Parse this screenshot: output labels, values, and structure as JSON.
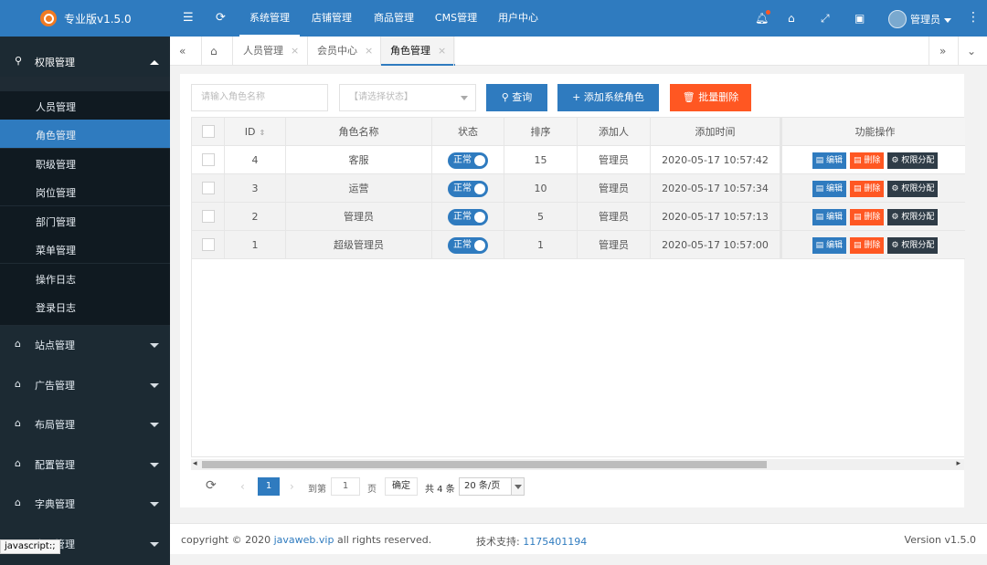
{
  "app": {
    "title": "专业版v1.5.0"
  },
  "header": {
    "nav": [
      "系统管理",
      "店铺管理",
      "商品管理",
      "CMS管理",
      "用户中心"
    ],
    "active_nav": "系统管理",
    "user": "管理员"
  },
  "sidebar": {
    "top_group": "权限管理",
    "items": [
      "人员管理",
      "角色管理",
      "职级管理",
      "岗位管理",
      "部门管理",
      "菜单管理",
      "操作日志",
      "登录日志"
    ],
    "active_item": "角色管理",
    "groups": [
      "站点管理",
      "广告管理",
      "布局管理",
      "配置管理",
      "字典管理",
      "应用管理"
    ]
  },
  "tabs": [
    {
      "label": "人员管理"
    },
    {
      "label": "会员中心"
    },
    {
      "label": "角色管理",
      "active": true
    }
  ],
  "toolbar": {
    "search_placeholder": "请输入角色名称",
    "status_placeholder": "【请选择状态】",
    "query": "查询",
    "add": "添加系统角色",
    "batch_delete": "批量删除"
  },
  "table": {
    "columns": [
      "ID",
      "角色名称",
      "状态",
      "排序",
      "添加人",
      "添加时间",
      "功能操作"
    ],
    "rows": [
      {
        "id": "4",
        "name": "客服",
        "status": "正常",
        "sort": "15",
        "creator": "管理员",
        "time": "2020-05-17 10:57:42"
      },
      {
        "id": "3",
        "name": "运营",
        "status": "正常",
        "sort": "10",
        "creator": "管理员",
        "time": "2020-05-17 10:57:34"
      },
      {
        "id": "2",
        "name": "管理员",
        "status": "正常",
        "sort": "5",
        "creator": "管理员",
        "time": "2020-05-17 10:57:13"
      },
      {
        "id": "1",
        "name": "超级管理员",
        "status": "正常",
        "sort": "1",
        "creator": "管理员",
        "time": "2020-05-17 10:57:00"
      }
    ],
    "actions": [
      "编辑",
      "删除",
      "权限分配"
    ]
  },
  "pager": {
    "current": "1",
    "goto_label": "到第",
    "goto_value": "1",
    "page_unit": "页",
    "confirm": "确定",
    "total": "共 4 条",
    "size": "20 条/页"
  },
  "footer": {
    "copyright_prefix": "copyright © 2020",
    "site": "javaweb.vip",
    "copyright_suffix": "all rights reserved.",
    "support_label": "技术支持:",
    "support_qq": "1175401194",
    "version": "Version v1.5.0"
  },
  "status_bar": "javascript:;",
  "colors": {
    "primary": "#2f7bbf",
    "danger": "#ff5722",
    "sidebar": "#1f2b34"
  }
}
